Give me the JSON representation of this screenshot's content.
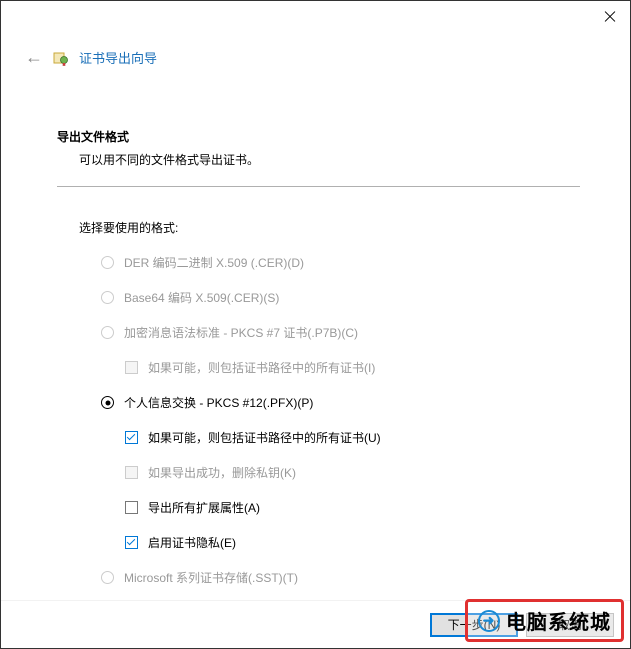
{
  "titlebar": {},
  "header": {
    "title": "证书导出向导"
  },
  "content": {
    "section_title": "导出文件格式",
    "section_desc": "可以用不同的文件格式导出证书。",
    "format_label": "选择要使用的格式:",
    "options": {
      "der": {
        "label": "DER 编码二进制 X.509 (.CER)(D)"
      },
      "base64": {
        "label": "Base64 编码 X.509(.CER)(S)"
      },
      "pkcs7": {
        "label": "加密消息语法标准 - PKCS #7 证书(.P7B)(C)",
        "include_all": "如果可能，则包括证书路径中的所有证书(I)"
      },
      "pkcs12": {
        "label": "个人信息交换 - PKCS #12(.PFX)(P)",
        "include_all": "如果可能，则包括证书路径中的所有证书(U)",
        "delete_key": "如果导出成功，删除私钥(K)",
        "export_ext": "导出所有扩展属性(A)",
        "cert_privacy": "启用证书隐私(E)"
      },
      "microsoft": {
        "label": "Microsoft 系列证书存储(.SST)(T)"
      }
    }
  },
  "footer": {
    "next": "下一步(N)",
    "cancel": "取消"
  },
  "watermark": {
    "text": "电脑系统城"
  }
}
